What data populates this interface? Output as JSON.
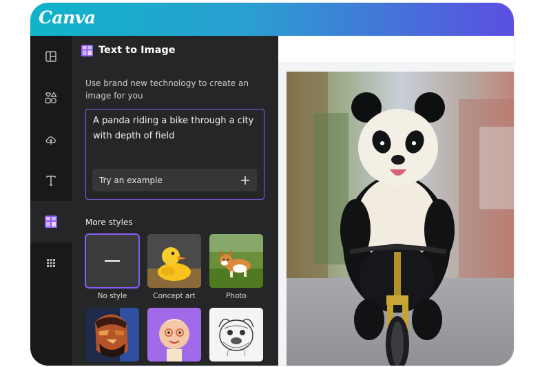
{
  "app": {
    "logo_text": "Canva"
  },
  "sidebar": {
    "items": [
      {
        "name": "design-templates",
        "icon": "layout-icon"
      },
      {
        "name": "elements",
        "icon": "shapes-icon"
      },
      {
        "name": "uploads",
        "icon": "cloud-upload-icon"
      },
      {
        "name": "text",
        "icon": "text-icon"
      },
      {
        "name": "text-to-image",
        "icon": "text-to-image-icon",
        "active": true
      },
      {
        "name": "apps",
        "icon": "grid-icon"
      }
    ]
  },
  "panel": {
    "title": "Text to Image",
    "description": "Use brand new technology to create an image for you",
    "prompt_value": "A panda riding a bike through a city with depth of field",
    "try_example_label": "Try an example",
    "more_styles_label": "More styles",
    "styles": [
      {
        "label": "No style",
        "selected": true
      },
      {
        "label": "Concept art"
      },
      {
        "label": "Photo"
      },
      {
        "label": ""
      },
      {
        "label": ""
      },
      {
        "label": ""
      }
    ]
  },
  "colors": {
    "accent": "#8b5cf6",
    "header_gradient_start": "#0fb4c9",
    "header_gradient_end": "#5b4fe0",
    "panel_bg": "#252627",
    "rail_bg": "#18191b"
  }
}
